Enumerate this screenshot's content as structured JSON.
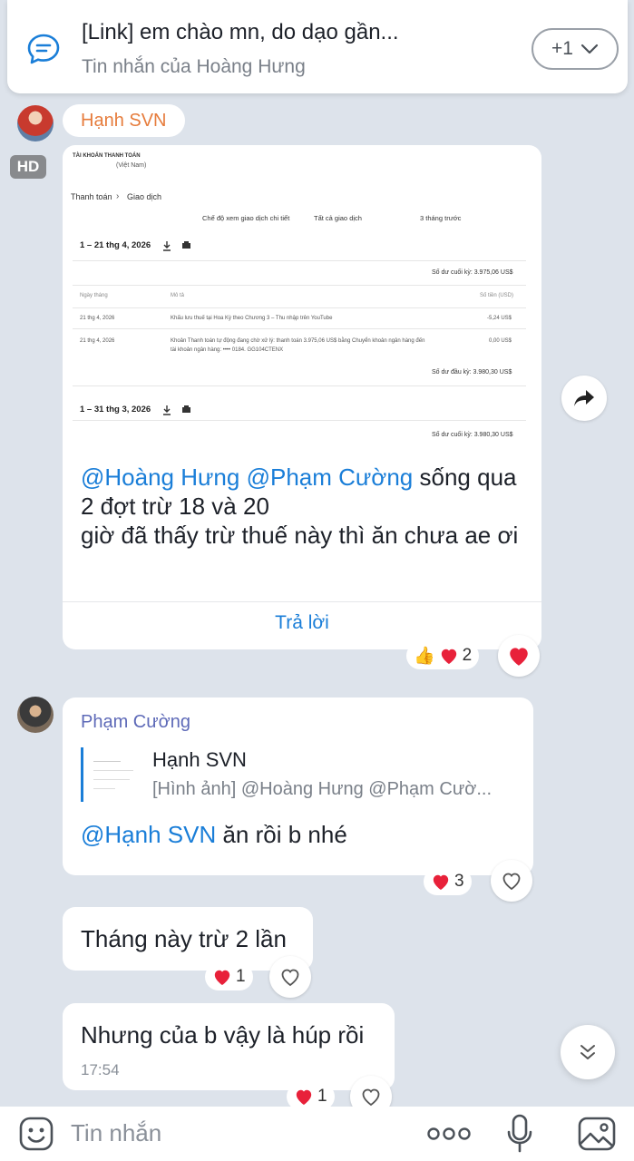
{
  "pinned": {
    "title": "[Link] em chào mn, do dạo gần...",
    "subtitle": "Tin nhắn của Hoàng Hưng",
    "more_label": "+1"
  },
  "messages": {
    "m1": {
      "sender": "Hạnh SVN",
      "hd_label": "HD",
      "screenshot": {
        "account_title": "TÀI KHOẢN THANH TOÁN",
        "account_sub": "(Việt Nam)",
        "breadcrumb_1": "Thanh toán",
        "breadcrumb_sep": "›",
        "breadcrumb_2": "Giao dịch",
        "filter_1": "Chế độ xem giao dịch chi tiết",
        "filter_2": "Tất cả giao dịch",
        "filter_3": "3 tháng trước",
        "period_1": "1 – 21 thg 4, 2026",
        "closing_1": "Số dư cuối kỳ: 3.975,06 US$",
        "col_date": "Ngày tháng",
        "col_desc": "Mô tả",
        "col_amount": "Số tiền (USD)",
        "rows": [
          {
            "date": "21 thg 4, 2026",
            "desc": "Khấu lưu thuế tại Hoa Kỳ theo Chương 3 – Thu nhập trên YouTube",
            "desc2": "",
            "amount": "-5,24 US$"
          },
          {
            "date": "21 thg 4, 2026",
            "desc": "Khoản Thanh toán tự động đang chờ xử lý: thanh toán 3.975,06 US$ bằng Chuyển khoản ngân hàng đến",
            "desc2": "tài khoản ngân hàng: •••• 0184. GG104CTENX",
            "amount": "0,00 US$"
          }
        ],
        "opening_1": "Số dư đầu kỳ: 3.980,30 US$",
        "period_2": "1 – 31 thg 3, 2026",
        "closing_2": "Số dư cuối kỳ: 3.980,30 US$"
      },
      "caption": {
        "mention_1": "@Hoàng Hưng",
        "mention_2": "@Phạm Cường",
        "text_1": " sống qua 2 đợt trừ 18 và 20",
        "text_2": "giờ đã thấy trừ thuế này thì ăn chưa ae ơi"
      },
      "reply_label": "Trả lời",
      "reaction_count": "2"
    },
    "m2": {
      "sender": "Phạm Cường",
      "quote_name": "Hạnh SVN",
      "quote_text": "[Hình ảnh] @Hoàng Hưng  @Phạm Cườ...",
      "mention": "@Hạnh SVN",
      "text": " ăn rồi b nhé",
      "reaction_count": "3"
    },
    "m3": {
      "text": "Tháng này trừ 2 lần",
      "reaction_count": "1"
    },
    "m4": {
      "text": "Nhưng của b vậy là húp rồi",
      "time": "17:54",
      "reaction_count": "1"
    }
  },
  "input": {
    "placeholder": "Tin nhắn"
  },
  "colors": {
    "accent": "#1a7ed8",
    "background": "#dde3eb",
    "heart": "#e8213a"
  }
}
